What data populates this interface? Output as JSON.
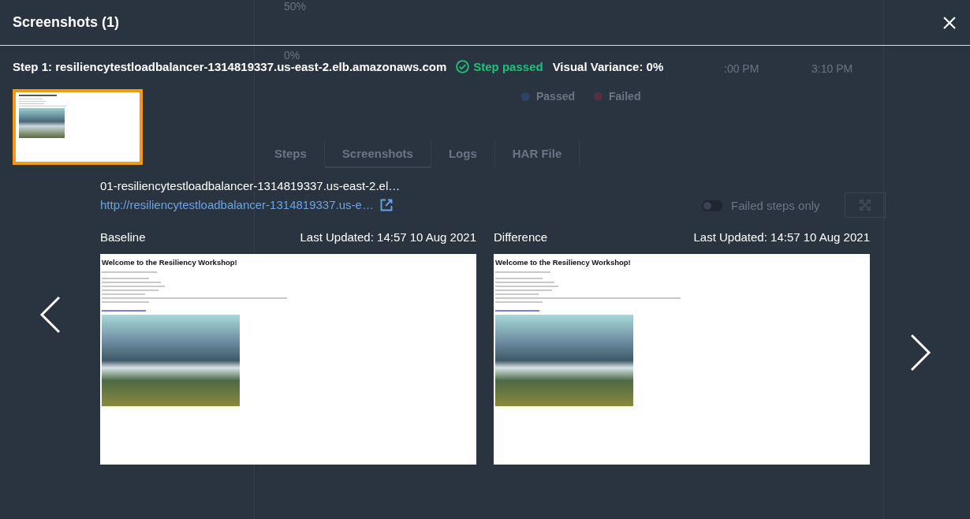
{
  "background_page": {
    "chart_yticks": [
      "50%",
      "0%"
    ],
    "chart_xticks": [
      ":00 PM",
      "3:10 PM"
    ],
    "legend": [
      {
        "label": "Passed",
        "color": "#2c4466"
      },
      {
        "label": "Failed",
        "color": "#563040"
      }
    ],
    "tabs": [
      {
        "label": "Steps",
        "selected": false
      },
      {
        "label": "Screenshots",
        "selected": true
      },
      {
        "label": "Logs",
        "selected": false
      },
      {
        "label": "HAR File",
        "selected": false
      }
    ],
    "toggle": {
      "label": "Failed steps only",
      "on": false
    }
  },
  "modal": {
    "title": "Screenshots (1)",
    "step": {
      "label": "Step 1: resiliencytestloadbalancer-1314819337.us-east-2.elb.amazonaws.com",
      "status": "Step passed",
      "variance": "Visual Variance: 0%"
    },
    "thumbnails": [
      {
        "selected": true
      }
    ],
    "file_name": "01-resiliencytestloadbalancer-1314819337.us-east-2.el…",
    "url": "http://resiliencytestloadbalancer-1314819337.us-e…",
    "previews": [
      {
        "label": "Baseline",
        "updated": "Last Updated: 14:57 10 Aug 2021",
        "page_heading": "Welcome to the Resiliency Workshop!"
      },
      {
        "label": "Difference",
        "updated": "Last Updated: 14:57 10 Aug 2021",
        "page_heading": "Welcome to the Resiliency Workshop!"
      }
    ]
  }
}
